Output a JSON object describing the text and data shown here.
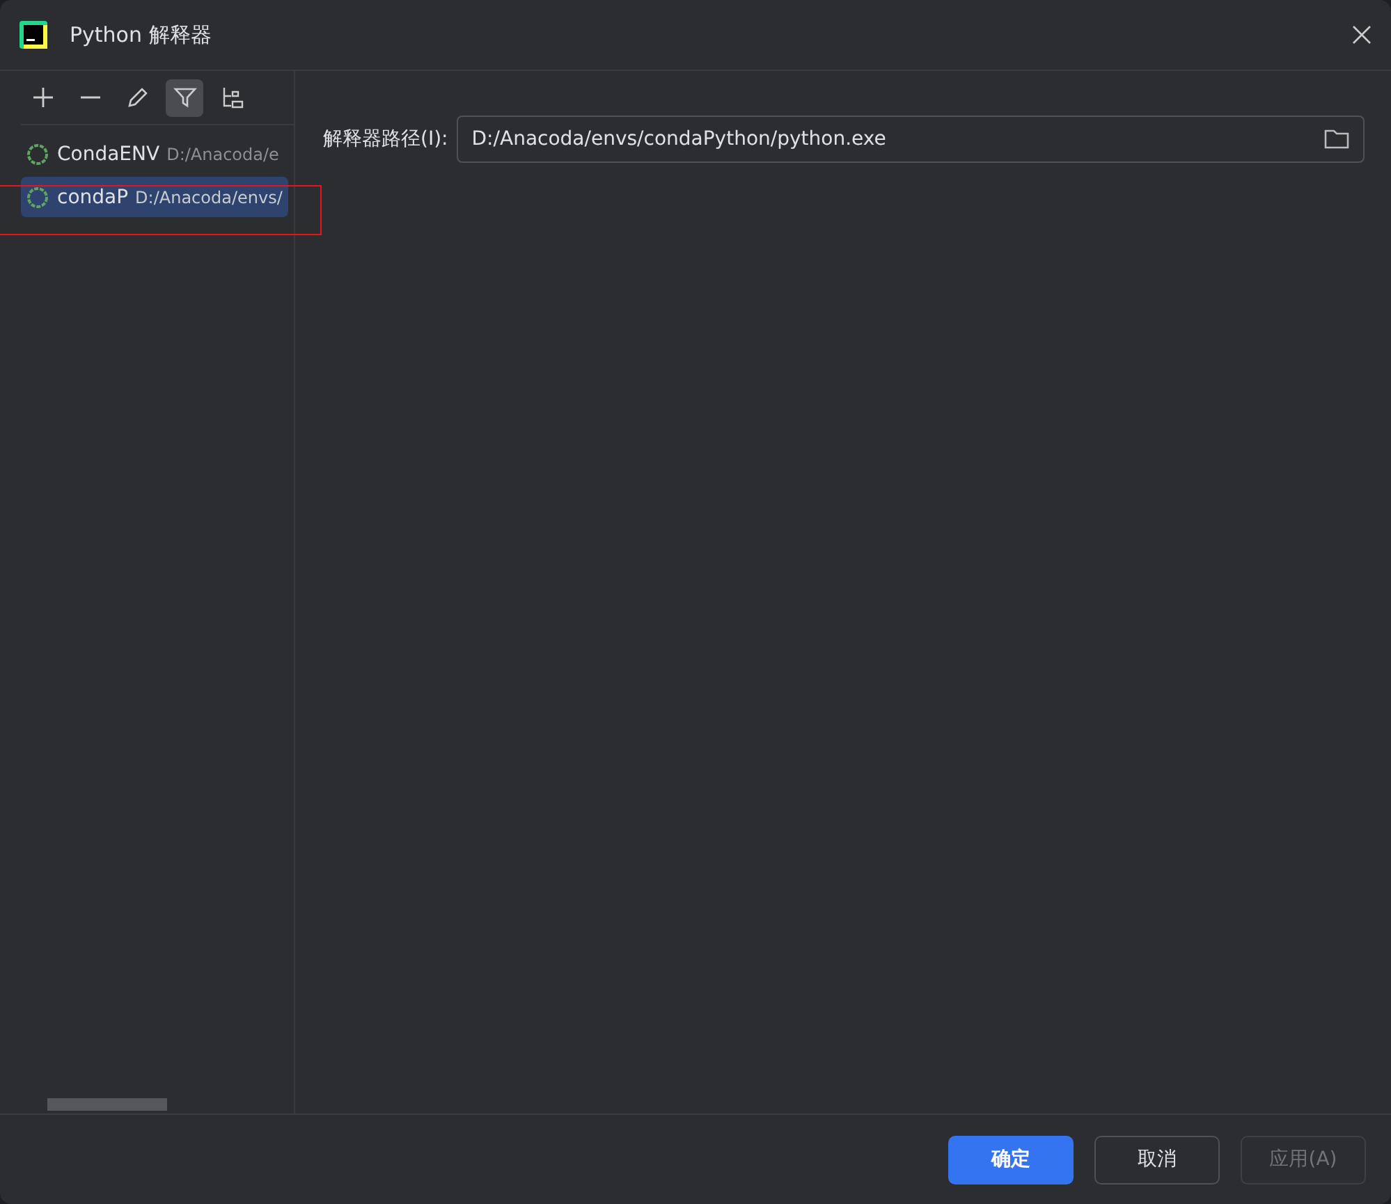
{
  "window": {
    "title": "Python 解释器"
  },
  "toolbar": [
    {
      "kind": "add",
      "selected": false
    },
    {
      "kind": "remove",
      "selected": false
    },
    {
      "kind": "edit",
      "selected": false
    },
    {
      "kind": "filter",
      "selected": true
    },
    {
      "kind": "tree",
      "selected": false
    }
  ],
  "interpreters": [
    {
      "name": "CondaENV",
      "path": "D:/Anacoda/e",
      "selected": false
    },
    {
      "name": "condaP",
      "path": "D:/Anacoda/envs/",
      "selected": true
    }
  ],
  "path_field": {
    "label": "解释器路径(I):",
    "value": "D:/Anacoda/envs/condaPython/python.exe"
  },
  "buttons": [
    {
      "label": "确定",
      "kind": "primary",
      "disabled": false
    },
    {
      "label": "取消",
      "kind": "normal",
      "disabled": false
    },
    {
      "label": "应用(A)",
      "kind": "normal",
      "disabled": true
    }
  ]
}
